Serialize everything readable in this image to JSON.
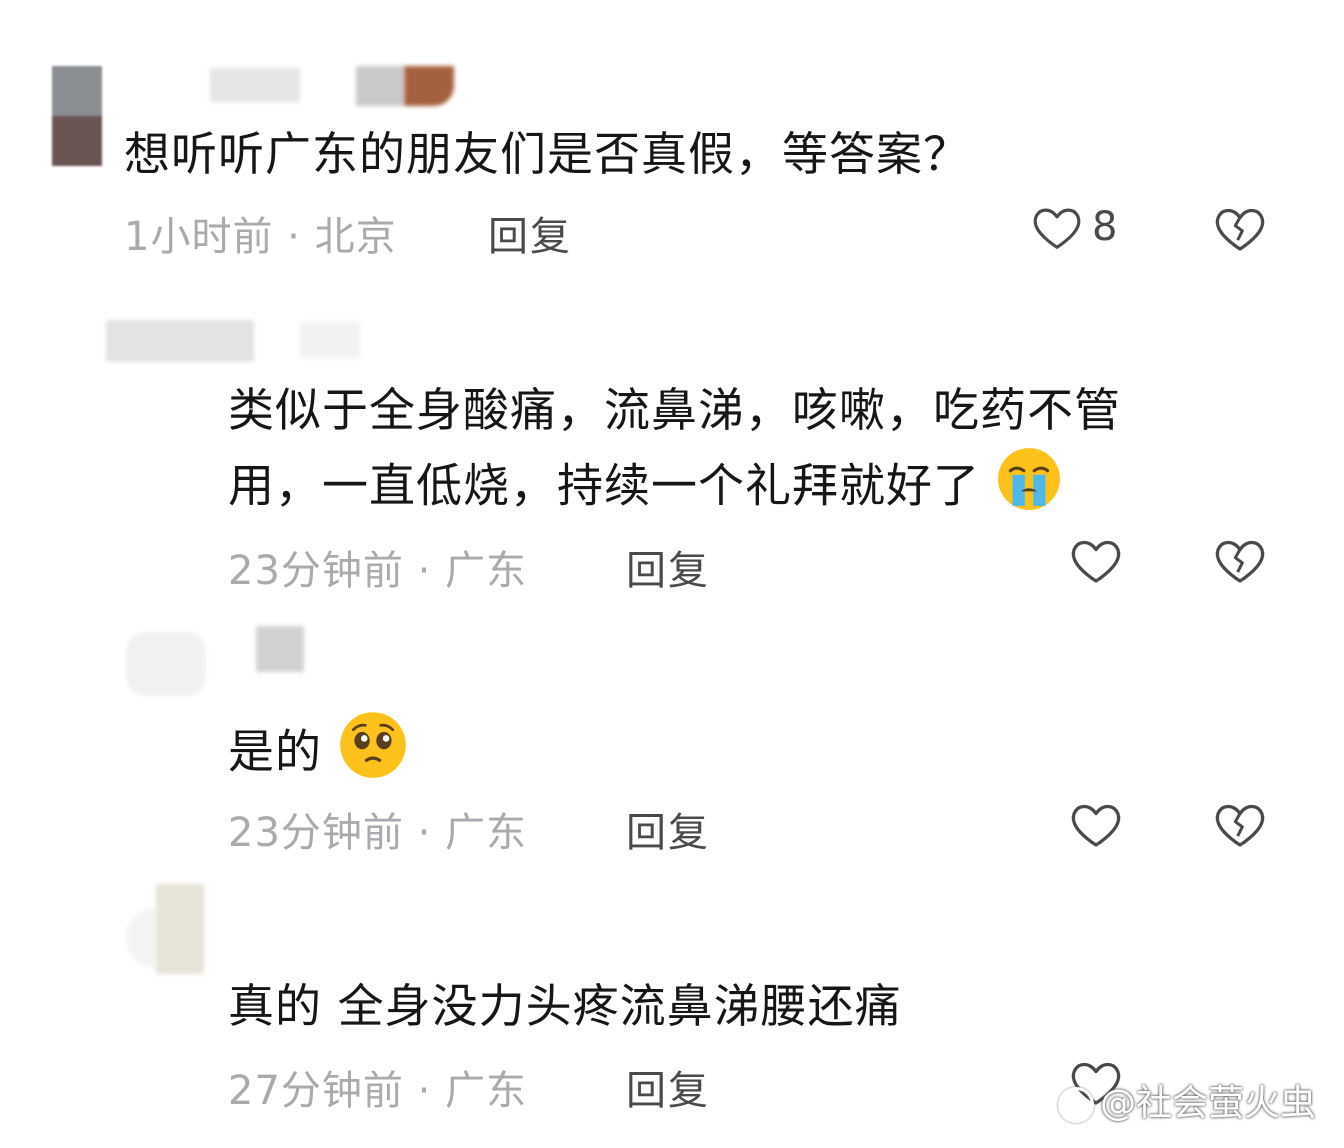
{
  "comments": [
    {
      "text": "想听听广东的朋友们是否真假，等答案？",
      "meta": "1小时前 · 北京",
      "reply": "回复",
      "likes": "8"
    },
    {
      "lines": [
        "类似于全身酸痛，流鼻涕，咳嗽，吃药不管",
        "用，一直低烧，持续一个礼拜就好了"
      ],
      "emoji": "crying-face",
      "meta": "23分钟前 · 广东",
      "reply": "回复"
    },
    {
      "text": "是的",
      "emoji": "pleading-face",
      "meta": "23分钟前 · 广东",
      "reply": "回复"
    },
    {
      "text": "真的 全身没力头疼流鼻涕腰还痛",
      "meta": "27分钟前 · 广东",
      "reply": "回复"
    }
  ],
  "watermark": "@社会萤火虫",
  "icons": {
    "like": "heart-outline-icon",
    "dislike": "broken-heart-icon"
  },
  "colors": {
    "meta": "#a9a9ae",
    "emoji": "#fcc21b"
  }
}
